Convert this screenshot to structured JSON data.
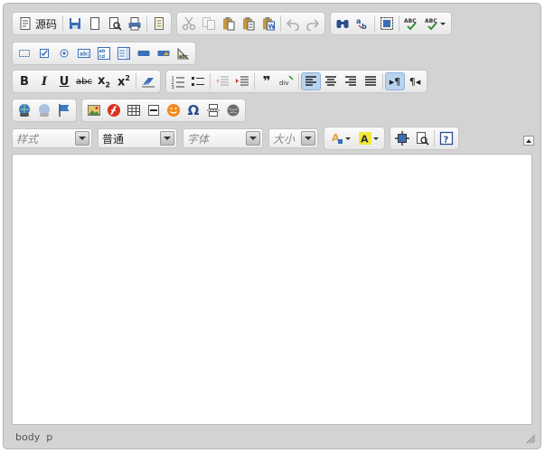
{
  "toolbar": {
    "source_label": "源码",
    "style_combo": {
      "label": "样式"
    },
    "format_combo": {
      "label": "普通"
    },
    "font_combo": {
      "label": "字体"
    },
    "size_combo": {
      "label": "大小"
    }
  },
  "elements_path": [
    "body",
    "p"
  ],
  "colors": {
    "frame": "#d3d3d3",
    "active_button": "#b8d4ef",
    "content_bg": "#ffffff"
  }
}
